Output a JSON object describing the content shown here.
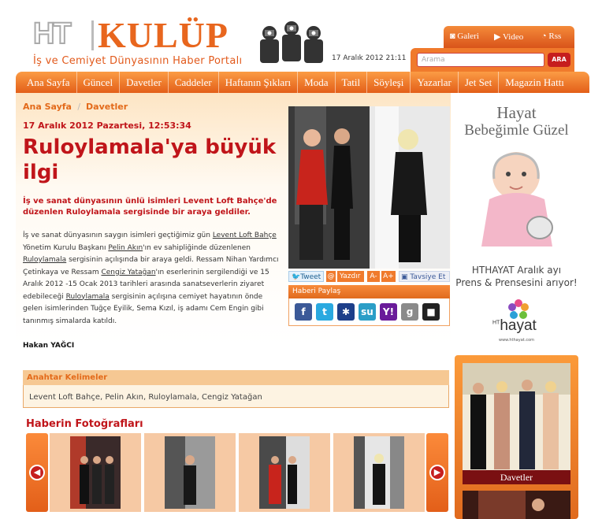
{
  "header": {
    "logo_ht": "HT",
    "logo_kulup": "KULÜP",
    "tagline": "İş ve Cemiyet Dünyasının Haber Portalı",
    "datetime": "17 Aralık 2012 21:11",
    "media": [
      {
        "label": "Galeri",
        "icon": "camera-icon"
      },
      {
        "label": "Video",
        "icon": "play-icon"
      },
      {
        "label": "Rss",
        "icon": "rss-icon"
      }
    ],
    "search": {
      "placeholder": "Arama",
      "button": "ARA"
    }
  },
  "nav": [
    "Ana Sayfa",
    "Güncel",
    "Davetler",
    "Caddeler",
    "Haftanın Şıkları",
    "Moda",
    "Tatil",
    "Söyleşi",
    "Yazarlar",
    "Jet Set",
    "Magazin Hattı"
  ],
  "article": {
    "breadcrumb": [
      "Ana Sayfa",
      "Davetler"
    ],
    "date": "17 Aralık 2012 Pazartesi, 12:53:34",
    "title": "Ruloylamala'ya büyük ilgi",
    "lead": "İş ve sanat dünyasının ünlü isimleri Levent Loft Bahçe'de düzenlen Ruloylamala sergisinde bir araya geldiler.",
    "body": {
      "p1": "İş ve sanat dünyasının saygın isimleri geçtiğimiz gün ",
      "l1": "Levent Loft Bahçe",
      "p2": " Yönetim Kurulu Başkanı ",
      "l2": "Pelin Akın",
      "p3": "'ın ev sahipliğinde düzenlenen ",
      "l3": "Ruloylamala",
      "p4": " sergisinin açılışında bir araya geldi. Ressam Nihan Yardımcı Çetinkaya ve Ressam ",
      "l4": "Cengiz Yatağan",
      "p5": "'ın eserlerinin sergilendiği ve 15 Aralık 2012 -15 Ocak 2013 tarihleri arasında sanatseverlerin ziyaret edebileceği ",
      "l5": "Ruloylamala",
      "p6": " sergisinin açılışına cemiyet hayatının önde gelen isimlerinden Tuğçe Eyilik, Sema Kızıl, iş adamı Cem Engin gibi tanınmış simalarda katıldı."
    },
    "author": "Hakan YAĞCI"
  },
  "share": {
    "tweet": "Tweet",
    "yazdir": "Yazdır",
    "font_down": "A-",
    "font_up": "A+",
    "recommend": "Tavsiye Et",
    "heading": "Haberi Paylaş",
    "icons": [
      {
        "name": "facebook-icon",
        "glyph": "f",
        "color": "#3b5998"
      },
      {
        "name": "twitter-icon",
        "glyph": "t",
        "color": "#2aa9e0"
      },
      {
        "name": "myspace-icon",
        "glyph": "✱",
        "color": "#1d3f8a"
      },
      {
        "name": "stumbleupon-icon",
        "glyph": "su",
        "color": "#2b9ec7"
      },
      {
        "name": "yahoo-icon",
        "glyph": "Y!",
        "color": "#6a1b9a"
      },
      {
        "name": "google-icon",
        "glyph": "g",
        "color": "#8a8a8a"
      },
      {
        "name": "delicious-icon",
        "glyph": "■",
        "color": "#222"
      }
    ]
  },
  "keywords": {
    "heading": "Anahtar Kelimeler",
    "text": "Levent Loft Bahçe, Pelin Akın, Ruloylamala, Cengiz Yatağan"
  },
  "gallery": {
    "title": "Haberin Fotoğrafları"
  },
  "ads": {
    "hayat": {
      "line1": "Hayat",
      "line2": "Bebeğimle Güzel",
      "promo1": "HTHAYAT Aralık ayı",
      "promo2": "Prens & Prensesini arıyor!",
      "brand": "hayat",
      "brand_prefix": "HT",
      "url": "www.hthayat.com"
    },
    "davetler": {
      "label": "Davetler"
    }
  }
}
